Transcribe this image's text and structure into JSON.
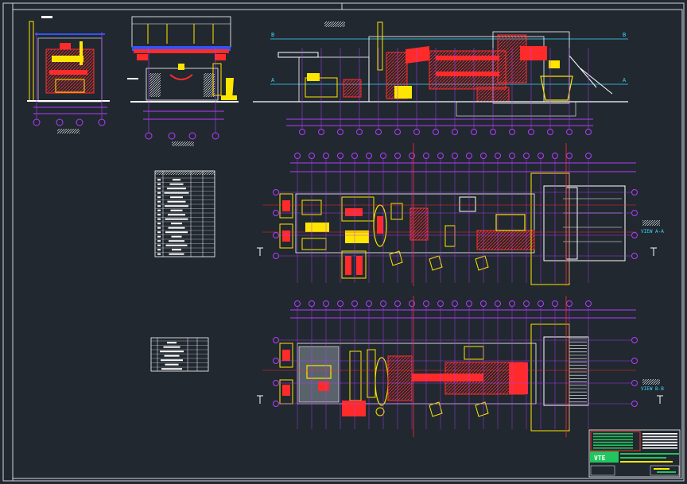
{
  "drawing": {
    "view_labels": {
      "view_a": "VIEW A-A",
      "view_b": "VIEW B-B"
    },
    "section_markers": {
      "b": "B",
      "a": "A"
    },
    "title_block": {
      "logo": "VTE"
    },
    "colors": {
      "background": "#212830",
      "frame": "#cfd6dd",
      "grid": "#b23cff",
      "equipment": "#ff2b2b",
      "yellow": "#ffe600",
      "white": "#ffffff",
      "cyan": "#39d7ff",
      "green": "#22c55e",
      "blue": "#2f55ff"
    }
  }
}
